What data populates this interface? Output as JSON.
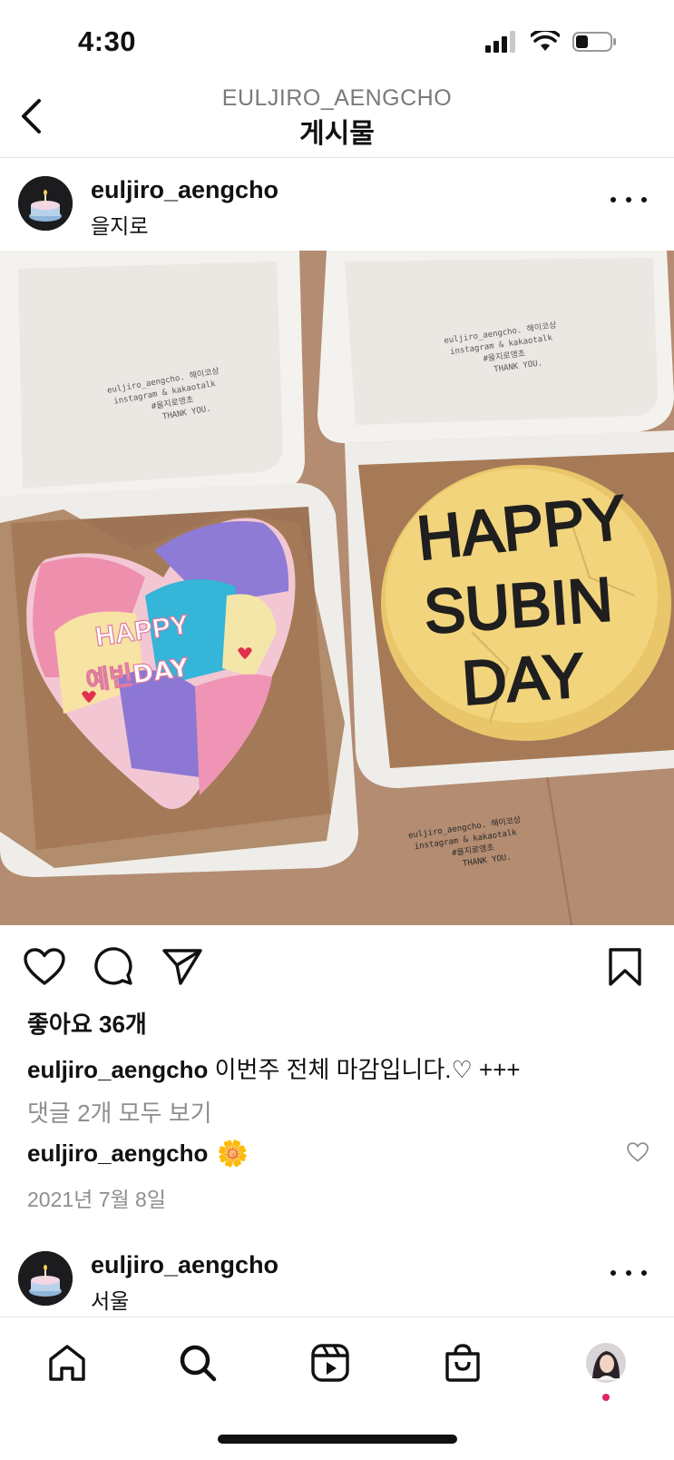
{
  "status_bar": {
    "time": "4:30",
    "signal_icon": "signal-bars-icon",
    "wifi_icon": "wifi-icon",
    "battery_icon": "battery-icon",
    "battery_level": 0.35
  },
  "header": {
    "account": "EULJIRO_AENGCHO",
    "title": "게시물",
    "back_icon": "chevron-left-icon"
  },
  "post": {
    "username": "euljiro_aengcho",
    "location": "을지로",
    "likes": "좋아요 36개",
    "caption_user": "euljiro_aengcho",
    "caption_text": "이번주 전체 마감입니다.♡ +++",
    "view_comments": "댓글 2개 모두 보기",
    "comment_user": "euljiro_aengcho",
    "comment_emoji": "🌼",
    "date": "2021년 7월 8일",
    "image": {
      "left_cake_text_1": "HAPPY",
      "left_cake_text_2": "예빈DAY",
      "right_cake_text_1": "HAPPY",
      "right_cake_text_2": "SUBIN",
      "right_cake_text_3": "DAY",
      "box_stamp_1": "euljiro_aengcho. 해이코상",
      "box_stamp_2": "instagram & kakaotalk",
      "box_stamp_3": "#을지로앵초",
      "box_stamp_4": "THANK YOU."
    }
  },
  "next_post": {
    "username": "euljiro_aengcho",
    "location": "서울"
  },
  "tabbar": {
    "items": [
      "home-icon",
      "search-icon",
      "reels-icon",
      "shop-icon",
      "profile-avatar"
    ]
  },
  "colors": {
    "text": "#111111",
    "muted": "#8e8e8e",
    "notification_dot": "#e0245e"
  }
}
